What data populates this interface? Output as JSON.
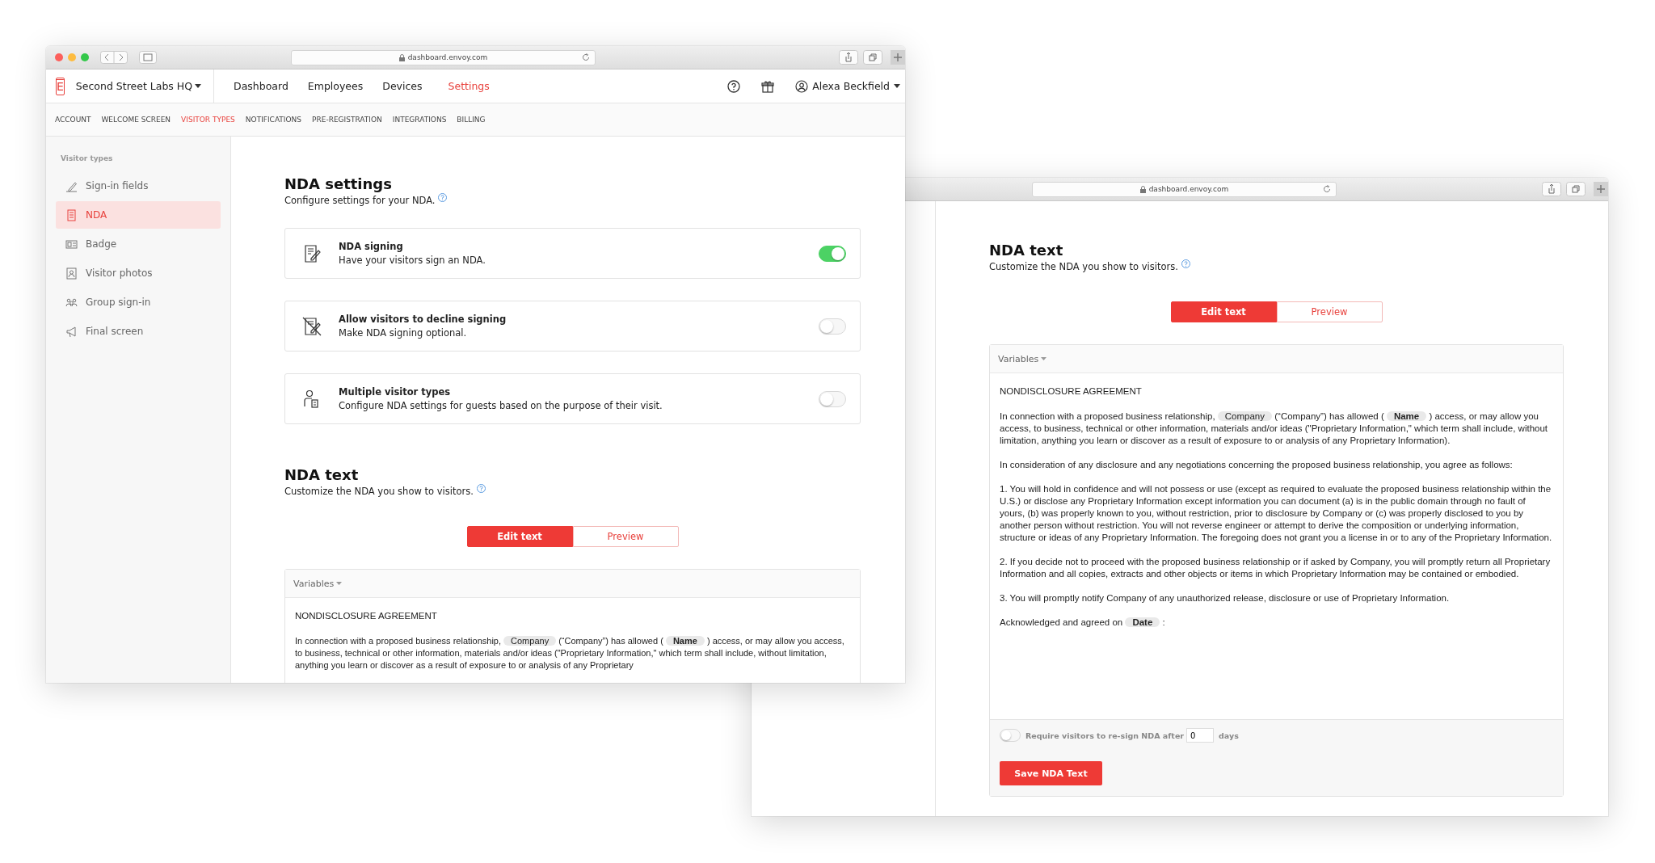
{
  "dashboard_window": {
    "url": "dashboard.envoy.com",
    "logo": "E",
    "location": "Second Street Labs HQ",
    "nav": [
      {
        "label": "Dashboard",
        "selected": false
      },
      {
        "label": "Employees",
        "selected": false
      },
      {
        "label": "Devices",
        "selected": false
      },
      {
        "label": "Settings",
        "selected": true
      }
    ],
    "user": "Alexa Beckfield",
    "subnav": [
      {
        "label": "ACCOUNT",
        "selected": false
      },
      {
        "label": "WELCOME SCREEN",
        "selected": false
      },
      {
        "label": "VISITOR TYPES",
        "selected": true
      },
      {
        "label": "NOTIFICATIONS",
        "selected": false
      },
      {
        "label": "PRE-REGISTRATION",
        "selected": false
      },
      {
        "label": "INTEGRATIONS",
        "selected": false
      },
      {
        "label": "BILLING",
        "selected": false
      }
    ],
    "sidebar": {
      "heading": "Visitor types",
      "items": [
        {
          "label": "Sign-in fields",
          "selected": false
        },
        {
          "label": "NDA",
          "selected": true
        },
        {
          "label": "Badge",
          "selected": false
        },
        {
          "label": "Visitor photos",
          "selected": false
        },
        {
          "label": "Group sign-in",
          "selected": false
        },
        {
          "label": "Final screen",
          "selected": false
        }
      ]
    },
    "settings": {
      "title": "NDA settings",
      "subtitle": "Configure settings for your NDA.",
      "cards": [
        {
          "title": "NDA signing",
          "description": "Have your visitors sign an NDA.",
          "on": true
        },
        {
          "title": "Allow visitors to decline signing",
          "description": "Make NDA signing optional.",
          "on": false
        },
        {
          "title": "Multiple visitor types",
          "description": "Configure NDA settings for guests based on the purpose of their visit.",
          "on": false
        }
      ]
    },
    "nda_text": {
      "title": "NDA text",
      "subtitle": "Customize the NDA you show to visitors.",
      "tabs": [
        {
          "label": "Edit text",
          "selected": true
        },
        {
          "label": "Preview",
          "selected": false
        }
      ],
      "variables_label": "Variables",
      "document": {
        "heading": "NONDISCLOSURE AGREEMENT",
        "paragraphs": [
          [
            {
              "kind": "text",
              "text": "In connection with a proposed business relationship,"
            },
            {
              "kind": "chip",
              "text": "Company",
              "bold": false
            },
            {
              "kind": "text",
              "text": "(“Company”) has allowed ("
            },
            {
              "kind": "chip",
              "text": "Name",
              "bold": true
            },
            {
              "kind": "text",
              "text": ") access, or may allow you access, to business, technical or other information, materials and/or ideas (\"Proprietary Information,\" which term shall include, without limitation, anything you learn or discover as a result of exposure to or analysis of any Proprietary"
            }
          ]
        ]
      }
    }
  },
  "nda_window": {
    "url": "dashboard.envoy.com",
    "nda_text": {
      "title": "NDA text",
      "subtitle": "Customize the NDA you show to visitors.",
      "tabs": [
        {
          "label": "Edit text",
          "selected": true
        },
        {
          "label": "Preview",
          "selected": false
        }
      ],
      "variables_label": "Variables",
      "document": {
        "heading": "NONDISCLOSURE AGREEMENT",
        "paragraphs": [
          [
            {
              "kind": "text",
              "text": "In connection with a proposed business relationship,"
            },
            {
              "kind": "chip",
              "text": "Company",
              "bold": false
            },
            {
              "kind": "text",
              "text": "(“Company”) has allowed ("
            },
            {
              "kind": "chip",
              "text": "Name",
              "bold": true
            },
            {
              "kind": "text",
              "text": ") access, or may allow you access, to business, technical or other information, materials and/or ideas (\"Proprietary Information,\" which term shall include, without limitation, anything you learn or discover as a result of exposure to or analysis of any Proprietary Information)."
            }
          ],
          [
            {
              "kind": "text",
              "text": "In consideration of any disclosure and any negotiations concerning the proposed business relationship, you agree as follows:"
            }
          ],
          [
            {
              "kind": "text",
              "text": "1. You will hold in confidence and will not possess or use (except as required to evaluate the proposed business relationship within the U.S.) or disclose any Proprietary Information except information you can document (a) is in the public domain through no fault of yours, (b) was properly known to you, without restriction, prior to disclosure by Company or (c) was properly disclosed to you by another person without restriction. You will not reverse engineer or attempt to derive the composition or underlying information, structure or ideas of any Proprietary Information. The foregoing does not grant you a license in or to any of the Proprietary Information."
            }
          ],
          [
            {
              "kind": "text",
              "text": "2. If you decide not to proceed with the proposed business relationship or if asked by Company, you will promptly return all Proprietary Information and all copies, extracts and other objects or items in which Proprietary Information may be contained or embodied."
            }
          ],
          [
            {
              "kind": "text",
              "text": "3. You will promptly notify Company of any unauthorized release, disclosure or use of Proprietary Information."
            }
          ],
          [
            {
              "kind": "text",
              "text": "Acknowledged and agreed on"
            },
            {
              "kind": "chip",
              "text": "Date",
              "bold": true
            },
            {
              "kind": "text",
              "text": ":"
            }
          ]
        ]
      }
    },
    "resign": {
      "on": false,
      "label": "Require visitors to re-sign NDA after",
      "value": "0",
      "unit": "days"
    },
    "save_button": "Save NDA Text"
  }
}
